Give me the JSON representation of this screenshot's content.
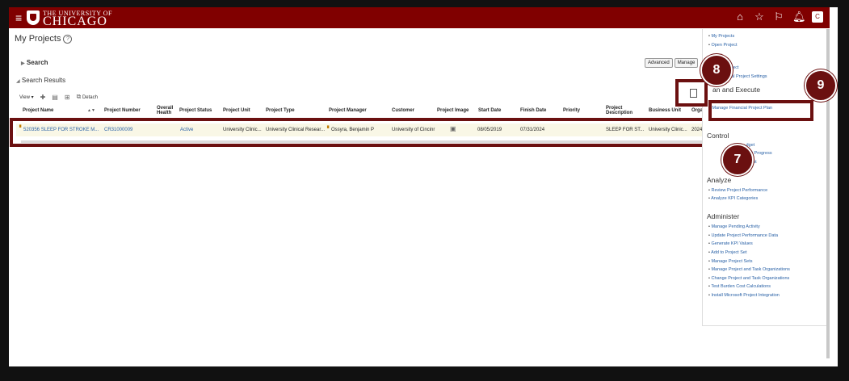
{
  "header": {
    "logo_top": "THE UNIVERSITY OF",
    "logo_bottom": "CHICAGO",
    "icons": [
      "hamburger-icon",
      "home-icon",
      "star-icon",
      "flag-icon",
      "bell-icon",
      "user-icon"
    ],
    "user_initials": "C",
    "brand_color": "#800000"
  },
  "page": {
    "title": "My Projects"
  },
  "search": {
    "label": "Search",
    "advanced_label": "Advanced",
    "manage_label": "Manage"
  },
  "results": {
    "label": "Search Results",
    "view_label": "View",
    "detach_label": "Detach",
    "columns": [
      "Project Name",
      "Project Number",
      "Overall Health",
      "Project Status",
      "Project Unit",
      "Project Type",
      "Project Manager",
      "Customer",
      "Project Image",
      "Start Date",
      "Finish Date",
      "Priority",
      "Project Description",
      "Business Unit",
      "Orga"
    ],
    "rows": [
      {
        "project_name": "520356 SLEEP FOR STROKE M...",
        "project_number": "CR31000009",
        "overall_health": "",
        "status": "Active",
        "unit": "University Clinic...",
        "type": "University Clinical Resear...",
        "manager": "Ossyra, Benjamin P",
        "customer": "University of Cincinr",
        "start_date": "08/05/2019",
        "finish_date": "07/31/2024",
        "priority": "",
        "description": "SLEEP FOR ST...",
        "business_unit": "University Clinic...",
        "org": "2024"
      }
    ]
  },
  "panel": {
    "top_links": [
      "My Projects",
      "Open Project",
      "Project",
      "Financial Project Settings"
    ],
    "plan_heading": "an and Execute",
    "plan_links": [
      "Manage Financial Project Plan"
    ],
    "control_heading": "Control",
    "control_links": [
      "dget",
      "ject Progress",
      "ecast"
    ],
    "analyze_heading": "Analyze",
    "analyze_links": [
      "Review Project Performance",
      "Analyze KPI Categories"
    ],
    "administer_heading": "Administer",
    "administer_links": [
      "Manage Pending Activity",
      "Update Project Performance Data",
      "Generate KPI Values",
      "Add to Project Set",
      "Manage Project Sets",
      "Manage Project and Task Organizations",
      "Change Project and Task Organizations",
      "Test Burden Cost Calculations",
      "Install Microsoft Project Integration"
    ]
  },
  "annotations": {
    "step7": "7",
    "step8": "8",
    "step9": "9",
    "color": "#6b1010"
  }
}
